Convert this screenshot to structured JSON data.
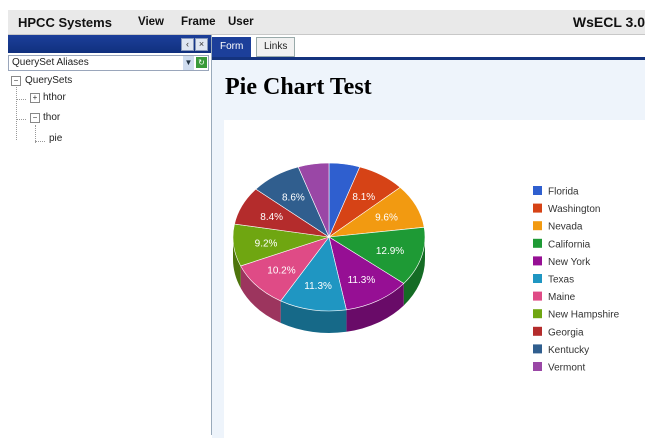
{
  "menubar": {
    "brand": "HPCC Systems",
    "menus": [
      "View",
      "Frame",
      "User"
    ],
    "version": "WsECL 3.0"
  },
  "left": {
    "combo_value": "QuerySet Aliases",
    "tree": [
      {
        "label": "QuerySets",
        "level": 0,
        "toggle": "−"
      },
      {
        "label": "hthor",
        "level": 1,
        "toggle": "+"
      },
      {
        "label": "thor",
        "level": 1,
        "toggle": "−"
      },
      {
        "label": "pie",
        "level": 2,
        "toggle": ""
      }
    ]
  },
  "tabs": [
    {
      "label": "Form",
      "active": true
    },
    {
      "label": "Links",
      "active": false
    }
  ],
  "page_title": "Pie Chart Test",
  "chart_data": {
    "type": "pie",
    "slices": [
      {
        "label": "Florida",
        "value": null,
        "pct_label": "",
        "color": "#2f5fcf"
      },
      {
        "label": "Washington",
        "value": 8.1,
        "pct_label": "8.1%",
        "color": "#d64316"
      },
      {
        "label": "Nevada",
        "value": 9.6,
        "pct_label": "9.6%",
        "color": "#f29a11"
      },
      {
        "label": "California",
        "value": 12.9,
        "pct_label": "12.9%",
        "color": "#1e9a35"
      },
      {
        "label": "New York",
        "value": 11.3,
        "pct_label": "11.3%",
        "color": "#960f94"
      },
      {
        "label": "Texas",
        "value": 11.3,
        "pct_label": "11.3%",
        "color": "#1f96c2"
      },
      {
        "label": "Maine",
        "value": 10.2,
        "pct_label": "10.2%",
        "color": "#df4b86"
      },
      {
        "label": "New Hampshire",
        "value": 9.2,
        "pct_label": "9.2%",
        "color": "#6fa611"
      },
      {
        "label": "Georgia",
        "value": 8.4,
        "pct_label": "8.4%",
        "color": "#b42c2c"
      },
      {
        "label": "Kentucky",
        "value": 8.6,
        "pct_label": "8.6%",
        "color": "#305e8e"
      },
      {
        "label": "Vermont",
        "value": null,
        "pct_label": "",
        "color": "#9a47a6"
      }
    ]
  }
}
